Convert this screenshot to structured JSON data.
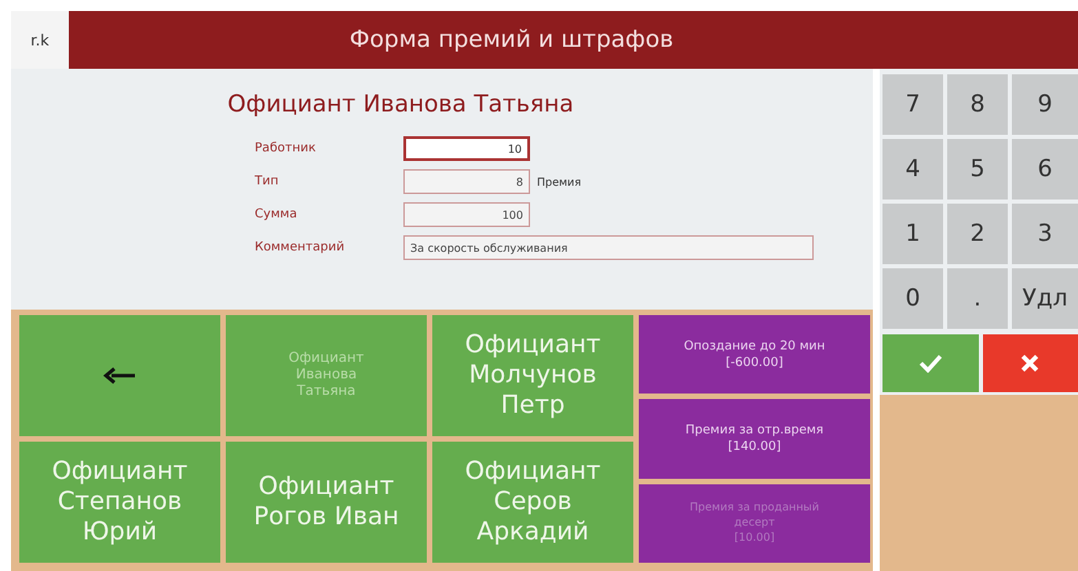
{
  "app_label": "r.k",
  "window": {
    "title": "Форма премий и штрафов"
  },
  "employee_title": "Официант Иванова Татьяна",
  "fields": [
    {
      "label": "Работник",
      "value": "10",
      "focused": true
    },
    {
      "label": "Тип",
      "value": "8",
      "focused": false,
      "suffix": "Премия"
    },
    {
      "label": "Сумма",
      "value": "100",
      "focused": false
    },
    {
      "label": "Комментарий",
      "value": "За скорость обслуживания",
      "focused": false,
      "kind": "wide"
    }
  ],
  "employee_buttons": [
    {
      "kind": "back"
    },
    {
      "kind": "name",
      "label": "Официант\nИванова\nТатьяна",
      "disabled": true
    },
    {
      "kind": "name",
      "label": "Официант\nМолчунов\nПетр",
      "disabled": false
    },
    {
      "kind": "name",
      "label": "Официант\nСтепанов\nЮрий",
      "disabled": false
    },
    {
      "kind": "name",
      "label": "Официант\nРогов Иван",
      "disabled": false
    },
    {
      "kind": "name",
      "label": "Официант\nСеров\nАркадий",
      "disabled": false
    }
  ],
  "bonus_buttons": [
    {
      "label": "Опоздание до 20 мин\n[-600.00]",
      "disabled": false
    },
    {
      "label": "Премия за отр.время\n[140.00]",
      "disabled": false
    },
    {
      "label": "Премия за проданный\nдесерт\n[10.00]",
      "disabled": true
    }
  ],
  "keypad": [
    "7",
    "8",
    "9",
    "4",
    "5",
    "6",
    "1",
    "2",
    "3",
    "0",
    ".",
    "Удл"
  ],
  "actions": [
    {
      "kind": "ok"
    },
    {
      "kind": "cancel"
    }
  ]
}
